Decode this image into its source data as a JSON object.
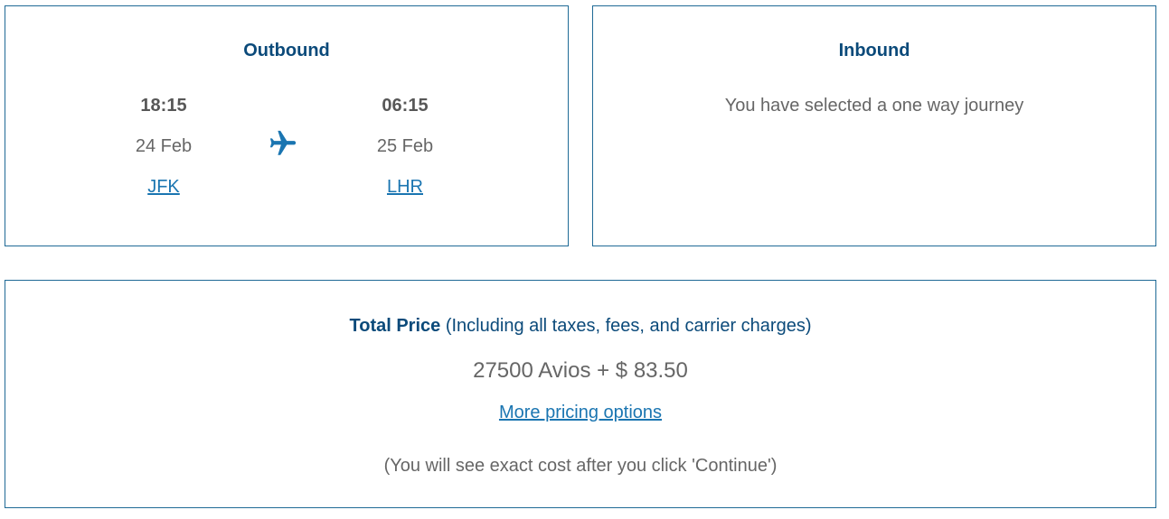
{
  "outbound": {
    "title": "Outbound",
    "departure": {
      "time": "18:15",
      "date": "24 Feb",
      "airport": "JFK"
    },
    "arrival": {
      "time": "06:15",
      "date": "25 Feb",
      "airport": "LHR"
    },
    "icon": "airplane-icon"
  },
  "inbound": {
    "title": "Inbound",
    "message": "You have selected a one way journey"
  },
  "price": {
    "label": "Total Price",
    "sublabel": "(Including all taxes, fees, and carrier charges)",
    "amount": "27500 Avios + $ 83.50",
    "more_options_link": "More pricing options",
    "note": "(You will see exact cost after you click 'Continue')"
  },
  "colors": {
    "border": "#1f6a96",
    "heading": "#0b4a7a",
    "link": "#1a75b1",
    "text": "#666666"
  }
}
